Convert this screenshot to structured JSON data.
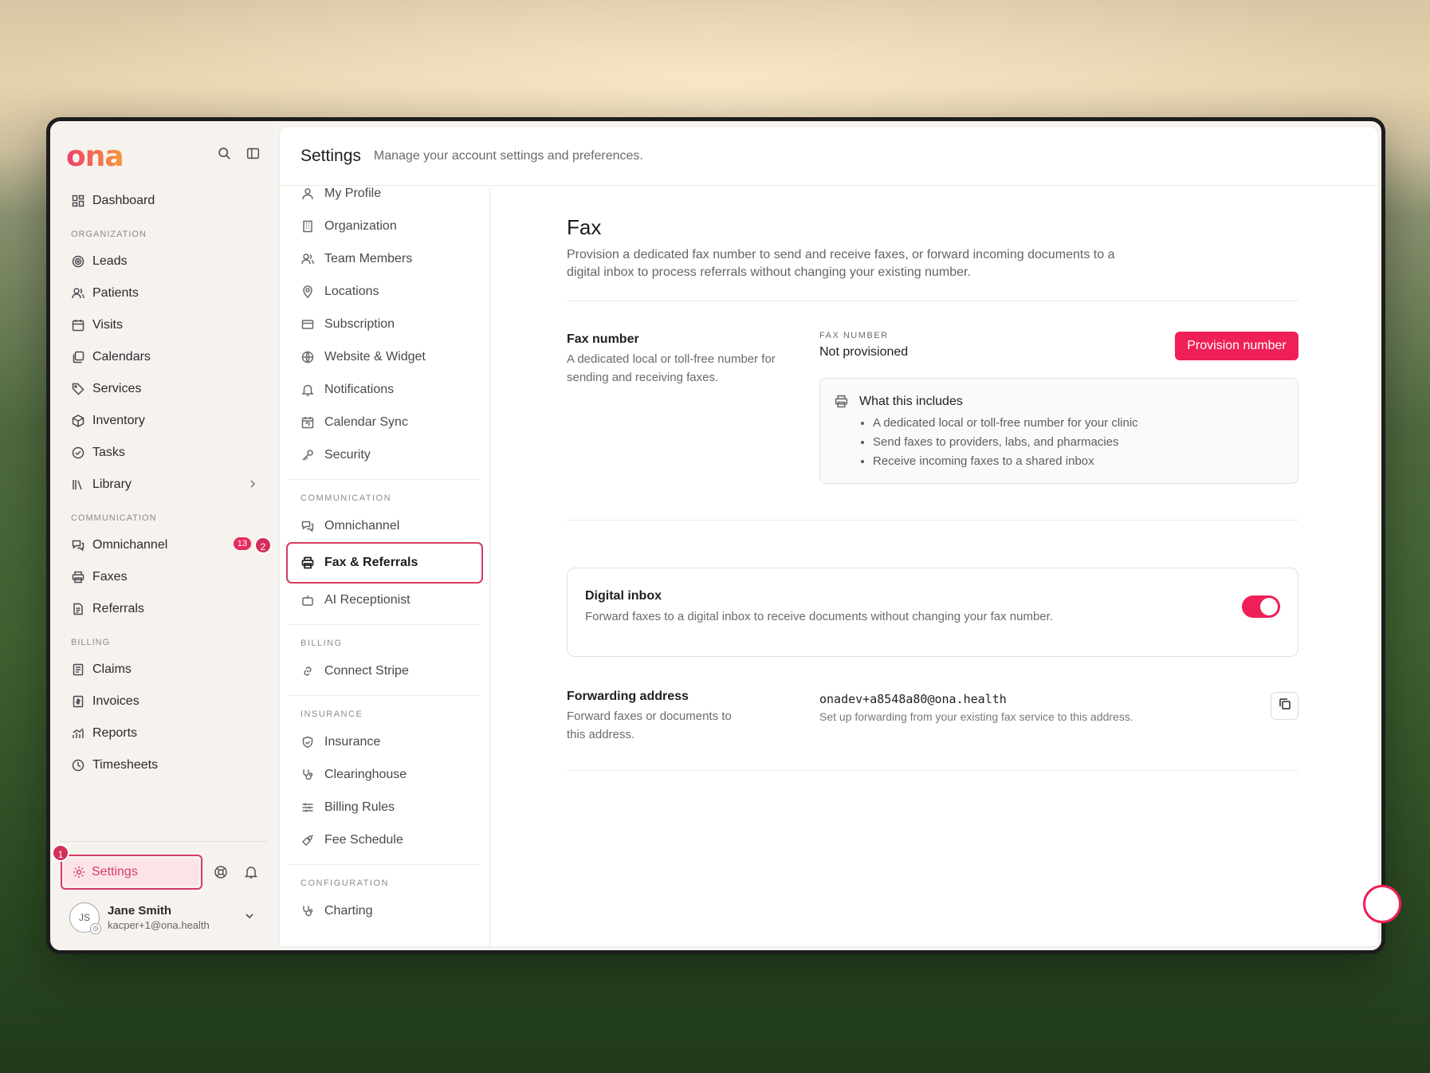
{
  "app": {
    "logo": "ona"
  },
  "sidebar": {
    "items": [
      {
        "label": "Dashboard",
        "icon": "dashboard-icon"
      }
    ],
    "org_section": "ORGANIZATION",
    "org_items": [
      {
        "label": "Leads",
        "icon": "target-icon"
      },
      {
        "label": "Patients",
        "icon": "users-icon"
      },
      {
        "label": "Visits",
        "icon": "calendar-icon"
      },
      {
        "label": "Calendars",
        "icon": "calendars-icon"
      },
      {
        "label": "Services",
        "icon": "tag-icon"
      },
      {
        "label": "Inventory",
        "icon": "box-icon"
      },
      {
        "label": "Tasks",
        "icon": "check-circle-icon"
      },
      {
        "label": "Library",
        "icon": "library-icon"
      }
    ],
    "comm_section": "COMMUNICATION",
    "comm_items": [
      {
        "label": "Omnichannel",
        "icon": "chat-icon",
        "badge": "13"
      },
      {
        "label": "Faxes",
        "icon": "printer-icon"
      },
      {
        "label": "Referrals",
        "icon": "document-icon"
      }
    ],
    "billing_section": "BILLING",
    "billing_items": [
      {
        "label": "Claims",
        "icon": "receipt-icon"
      },
      {
        "label": "Invoices",
        "icon": "invoice-icon"
      },
      {
        "label": "Reports",
        "icon": "chart-icon"
      },
      {
        "label": "Timesheets",
        "icon": "clock-icon"
      }
    ],
    "settings_label": "Settings",
    "step_1": "1",
    "step_2": "2",
    "user": {
      "initials": "JS",
      "name": "Jane Smith",
      "email": "kacper+1@ona.health"
    }
  },
  "header": {
    "title": "Settings",
    "subtitle": "Manage your account settings and preferences."
  },
  "subnav": {
    "top_items": [
      {
        "label": "My Profile",
        "icon": "user-icon"
      },
      {
        "label": "Organization",
        "icon": "building-icon"
      },
      {
        "label": "Team Members",
        "icon": "team-icon"
      },
      {
        "label": "Locations",
        "icon": "pin-icon"
      },
      {
        "label": "Subscription",
        "icon": "card-icon"
      },
      {
        "label": "Website & Widget",
        "icon": "globe-icon"
      },
      {
        "label": "Notifications",
        "icon": "bell-icon"
      },
      {
        "label": "Calendar Sync",
        "icon": "calendar-sync-icon"
      },
      {
        "label": "Security",
        "icon": "key-icon"
      }
    ],
    "communication_section": "COMMUNICATION",
    "communication_items": [
      {
        "label": "Omnichannel",
        "icon": "chat-icon"
      },
      {
        "label": "Fax & Referrals",
        "icon": "printer-icon",
        "active": true
      },
      {
        "label": "AI Receptionist",
        "icon": "bot-icon"
      }
    ],
    "billing_section": "BILLING",
    "billing_items": [
      {
        "label": "Connect Stripe",
        "icon": "link-icon"
      }
    ],
    "insurance_section": "INSURANCE",
    "insurance_items": [
      {
        "label": "Insurance",
        "icon": "shield-icon"
      },
      {
        "label": "Clearinghouse",
        "icon": "stethoscope-icon"
      },
      {
        "label": "Billing Rules",
        "icon": "sliders-icon"
      },
      {
        "label": "Fee Schedule",
        "icon": "fee-icon"
      }
    ],
    "configuration_section": "CONFIGURATION",
    "configuration_items": [
      {
        "label": "Charting",
        "icon": "stethoscope-icon"
      }
    ]
  },
  "content": {
    "title": "Fax",
    "description": "Provision a dedicated fax number to send and receive faxes, or forward incoming documents to a digital inbox to process referrals without changing your existing number.",
    "fax_number": {
      "label": "Fax number",
      "description": "A dedicated local or toll-free number for sending and receiving faxes.",
      "caption": "FAX NUMBER",
      "value": "Not provisioned",
      "button": "Provision number"
    },
    "includes": {
      "title": "What this includes",
      "items": [
        "A dedicated local or toll-free number for your clinic",
        "Send faxes to providers, labs, and pharmacies",
        "Receive incoming faxes to a shared inbox"
      ]
    },
    "digital_inbox": {
      "title": "Digital inbox",
      "description": "Forward faxes to a digital inbox to receive documents without changing your fax number.",
      "enabled": true
    },
    "forwarding": {
      "label": "Forwarding address",
      "description": "Forward faxes or documents to this address.",
      "address": "onadev+a8548a80@ona.health",
      "hint": "Set up forwarding from your existing fax service to this address."
    }
  },
  "colors": {
    "accent": "#ef1f57",
    "highlight": "#d63b63"
  }
}
